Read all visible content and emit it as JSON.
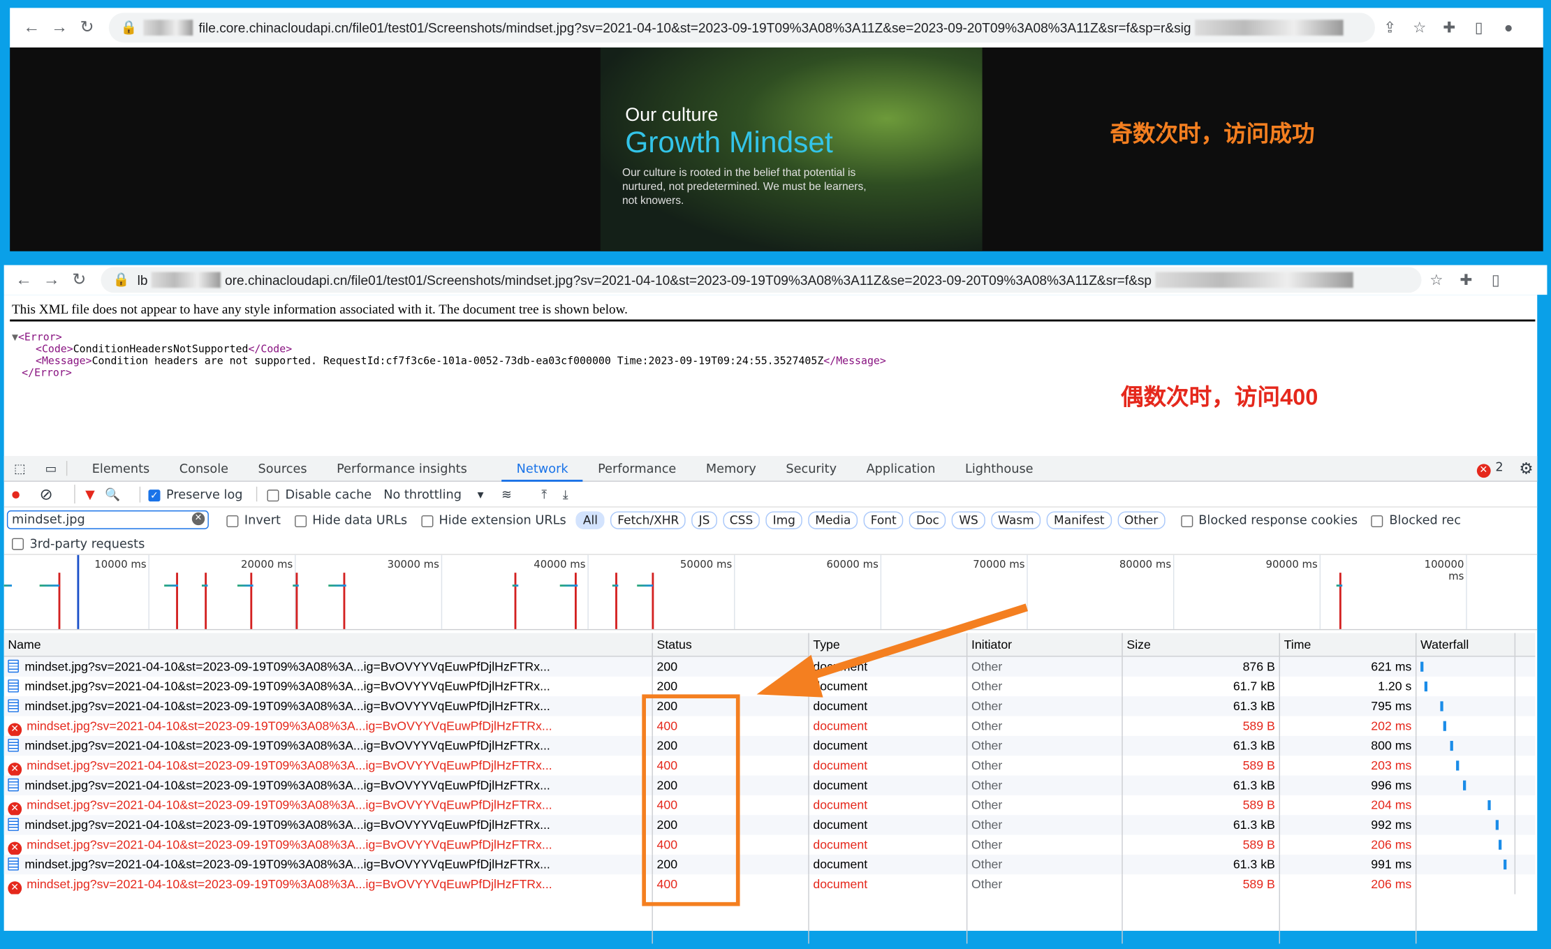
{
  "browser1": {
    "url": "file.core.chinacloudapi.cn/file01/test01/Screenshots/mindset.jpg?sv=2021-04-10&st=2023-09-19T09%3A08%3A11Z&se=2023-09-20T09%3A08%3A11Z&sr=f&sp=r&sig",
    "image": {
      "heading": "Our culture",
      "title": "Growth Mindset",
      "body": "Our culture is rooted in the belief that potential is nurtured, not predetermined. We must be learners, not knowers."
    }
  },
  "annotation_success": "奇数次时，访问成功",
  "annotation_fail": "偶数次时，访问400",
  "browser2": {
    "url_prefix": "lb",
    "url": "ore.chinacloudapi.cn/file01/test01/Screenshots/mindset.jpg?sv=2021-04-10&st=2023-09-19T09%3A08%3A11Z&se=2023-09-20T09%3A08%3A11Z&sr=f&sp",
    "xml_notice": "This XML file does not appear to have any style information associated with it. The document tree is shown below.",
    "xml": {
      "open": "<Error>",
      "code_open": "<Code>",
      "code": "ConditionHeadersNotSupported",
      "code_close": "</Code>",
      "msg_open": "<Message>",
      "message": "Condition headers are not supported. RequestId:cf7f3c6e-101a-0052-73db-ea03cf000000 Time:2023-09-19T09:24:55.3527405Z",
      "msg_close": "</Message>",
      "close": "</Error>"
    }
  },
  "devtools": {
    "tabs": [
      "Elements",
      "Console",
      "Sources",
      "Performance insights",
      "Network",
      "Performance",
      "Memory",
      "Security",
      "Application",
      "Lighthouse"
    ],
    "active_tab": "Network",
    "error_count": "2",
    "preserve_log": "Preserve log",
    "disable_cache": "Disable cache",
    "throttling": "No throttling",
    "filter_value": "mindset.jpg",
    "invert": "Invert",
    "hide_data": "Hide data URLs",
    "hide_ext": "Hide extension URLs",
    "types": [
      "All",
      "Fetch/XHR",
      "JS",
      "CSS",
      "Img",
      "Media",
      "Font",
      "Doc",
      "WS",
      "Wasm",
      "Manifest",
      "Other"
    ],
    "blocked_cookies": "Blocked response cookies",
    "blocked_req": "Blocked rec",
    "third_party": "3rd-party requests",
    "timeline_ticks": [
      "10000 ms",
      "20000 ms",
      "30000 ms",
      "40000 ms",
      "50000 ms",
      "60000 ms",
      "70000 ms",
      "80000 ms",
      "90000 ms",
      "100000 ms"
    ],
    "columns": [
      "Name",
      "Status",
      "Type",
      "Initiator",
      "Size",
      "Time",
      "Waterfall"
    ],
    "rows": [
      {
        "name": "mindset.jpg?sv=2021-04-10&st=2023-09-19T09%3A08%3A...ig=BvOVYYVqEuwPfDjlHzFTRx...",
        "status": "200",
        "type": "document",
        "initiator": "Other",
        "size": "876 B",
        "time": "621 ms",
        "error": false
      },
      {
        "name": "mindset.jpg?sv=2021-04-10&st=2023-09-19T09%3A08%3A...ig=BvOVYYVqEuwPfDjlHzFTRx...",
        "status": "200",
        "type": "document",
        "initiator": "Other",
        "size": "61.7 kB",
        "time": "1.20 s",
        "error": false
      },
      {
        "name": "mindset.jpg?sv=2021-04-10&st=2023-09-19T09%3A08%3A...ig=BvOVYYVqEuwPfDjlHzFTRx...",
        "status": "200",
        "type": "document",
        "initiator": "Other",
        "size": "61.3 kB",
        "time": "795 ms",
        "error": false
      },
      {
        "name": "mindset.jpg?sv=2021-04-10&st=2023-09-19T09%3A08%3A...ig=BvOVYYVqEuwPfDjlHzFTRx...",
        "status": "400",
        "type": "document",
        "initiator": "Other",
        "size": "589 B",
        "time": "202 ms",
        "error": true
      },
      {
        "name": "mindset.jpg?sv=2021-04-10&st=2023-09-19T09%3A08%3A...ig=BvOVYYVqEuwPfDjlHzFTRx...",
        "status": "200",
        "type": "document",
        "initiator": "Other",
        "size": "61.3 kB",
        "time": "800 ms",
        "error": false
      },
      {
        "name": "mindset.jpg?sv=2021-04-10&st=2023-09-19T09%3A08%3A...ig=BvOVYYVqEuwPfDjlHzFTRx...",
        "status": "400",
        "type": "document",
        "initiator": "Other",
        "size": "589 B",
        "time": "203 ms",
        "error": true
      },
      {
        "name": "mindset.jpg?sv=2021-04-10&st=2023-09-19T09%3A08%3A...ig=BvOVYYVqEuwPfDjlHzFTRx...",
        "status": "200",
        "type": "document",
        "initiator": "Other",
        "size": "61.3 kB",
        "time": "996 ms",
        "error": false
      },
      {
        "name": "mindset.jpg?sv=2021-04-10&st=2023-09-19T09%3A08%3A...ig=BvOVYYVqEuwPfDjlHzFTRx...",
        "status": "400",
        "type": "document",
        "initiator": "Other",
        "size": "589 B",
        "time": "204 ms",
        "error": true
      },
      {
        "name": "mindset.jpg?sv=2021-04-10&st=2023-09-19T09%3A08%3A...ig=BvOVYYVqEuwPfDjlHzFTRx...",
        "status": "200",
        "type": "document",
        "initiator": "Other",
        "size": "61.3 kB",
        "time": "992 ms",
        "error": false
      },
      {
        "name": "mindset.jpg?sv=2021-04-10&st=2023-09-19T09%3A08%3A...ig=BvOVYYVqEuwPfDjlHzFTRx...",
        "status": "400",
        "type": "document",
        "initiator": "Other",
        "size": "589 B",
        "time": "206 ms",
        "error": true
      },
      {
        "name": "mindset.jpg?sv=2021-04-10&st=2023-09-19T09%3A08%3A...ig=BvOVYYVqEuwPfDjlHzFTRx...",
        "status": "200",
        "type": "document",
        "initiator": "Other",
        "size": "61.3 kB",
        "time": "991 ms",
        "error": false
      },
      {
        "name": "mindset.jpg?sv=2021-04-10&st=2023-09-19T09%3A08%3A...ig=BvOVYYVqEuwPfDjlHzFTRx...",
        "status": "400",
        "type": "document",
        "initiator": "Other",
        "size": "589 B",
        "time": "206 ms",
        "error": true
      }
    ]
  },
  "colors": {
    "frame": "#0aa0e8",
    "annotation_orange": "#f47f20",
    "error_red": "#e5281c",
    "accent": "#1a73e8"
  }
}
